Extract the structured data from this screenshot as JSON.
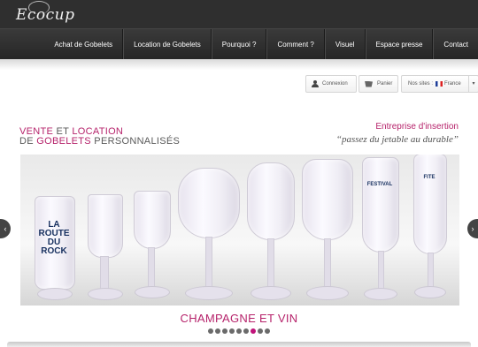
{
  "header": {
    "logo_text": "Ecocup",
    "nav": [
      {
        "label": "Achat de Gobelets"
      },
      {
        "label": "Location de Gobelets"
      },
      {
        "label": "Pourquoi ?"
      },
      {
        "label": "Comment ?"
      },
      {
        "label": "Visuel"
      },
      {
        "label": "Espace presse"
      },
      {
        "label": "Contact"
      }
    ]
  },
  "utility": {
    "login_label": "Connexion",
    "cart_label": "Panier",
    "sites_label": "Nos sites :",
    "country_label": "France",
    "icons": {
      "login": "user-icon",
      "cart": "cart-icon",
      "country": "flag-france-icon",
      "dropdown": "chevron-down-icon"
    }
  },
  "hero": {
    "title_line1_a": "VENTE",
    "title_line1_b": " ET ",
    "title_line1_c": "LOCATION",
    "title_line2_a": "DE ",
    "title_line2_b": "GOBELETS",
    "title_line2_c": " PERSONNALISÉS",
    "tagline_1": "Entreprise d'insertion",
    "tagline_2": "“passez du jetable au durable”"
  },
  "slider": {
    "caption": "CHAMPAGNE ET VIN",
    "print_1": "LA ROUTE DU ROCK",
    "print_2": "FESTIVAL",
    "print_3": "FITE",
    "dots_total": 9,
    "active_dot": 7,
    "prev_icon": "chevron-left-icon",
    "next_icon": "chevron-right-icon"
  },
  "colors": {
    "accent": "#b6236b",
    "header": "#2f2f2f",
    "dot": "#6a6a6a",
    "dot_active": "#c0137a"
  }
}
